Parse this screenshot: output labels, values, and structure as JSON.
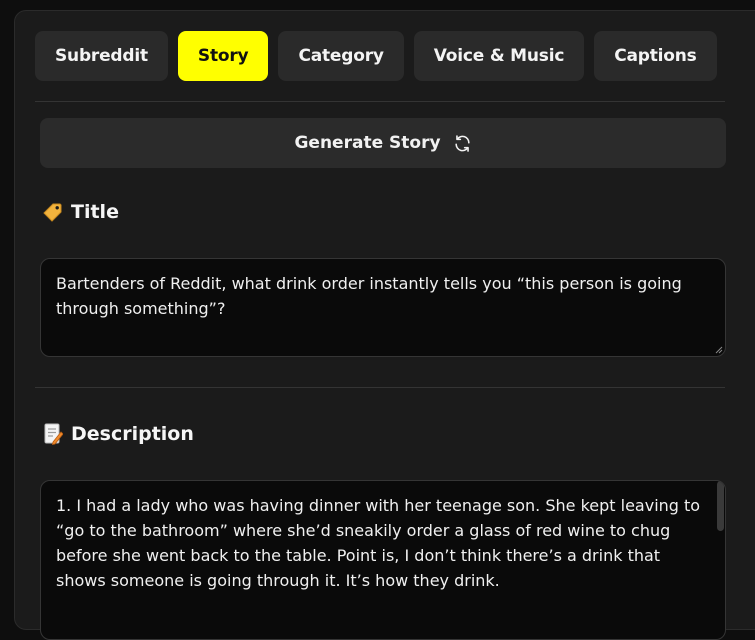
{
  "tabs": [
    {
      "label": "Subreddit",
      "active": false
    },
    {
      "label": "Story",
      "active": true
    },
    {
      "label": "Category",
      "active": false
    },
    {
      "label": "Voice & Music",
      "active": false
    },
    {
      "label": "Captions",
      "active": false
    }
  ],
  "generate_button": {
    "label": "Generate Story",
    "icon": "refresh-icon"
  },
  "title_section": {
    "label": "Title",
    "icon": "tag-icon",
    "value": "Bartenders of Reddit, what drink order instantly tells you “this person is going through something”?"
  },
  "description_section": {
    "label": "Description",
    "icon": "memo-icon",
    "value": "1. I had a lady who was having dinner with her teenage son. She kept leaving to “go to the bathroom” where she’d sneakily order a glass of red wine to chug before she went back to the table. Point is, I don’t think there’s a drink that shows someone is going through it. It’s how they drink."
  },
  "colors": {
    "accent": "#ffff00",
    "background": "#1b1b1b",
    "input_background": "#0a0a0a"
  }
}
